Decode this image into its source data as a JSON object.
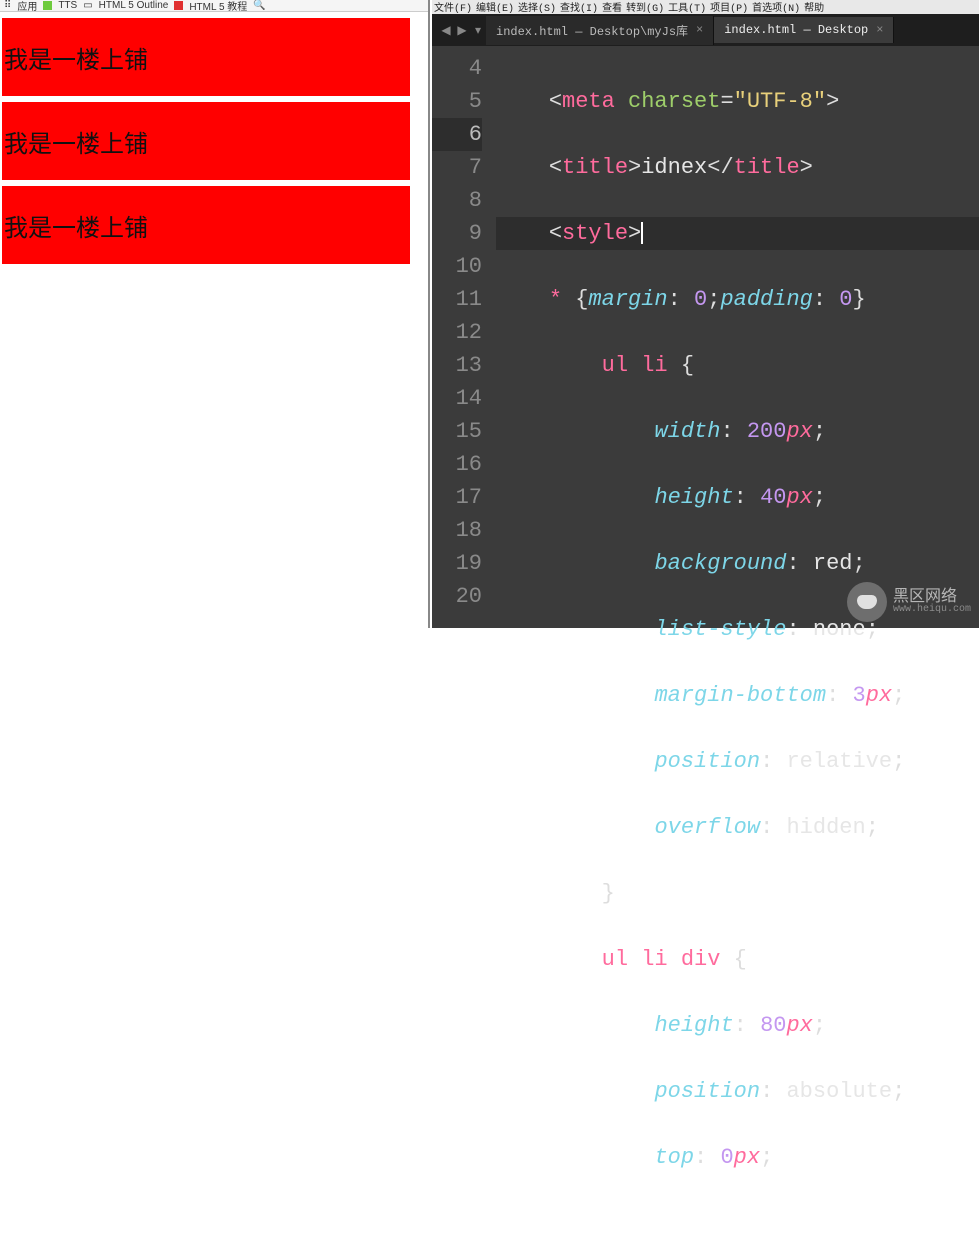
{
  "browser": {
    "bookmarks": {
      "apps": "应用",
      "tts": "TTS",
      "item1": "HTML 5 Outline",
      "item2": "HTML 5 教程"
    },
    "bars": {
      "b0": "我是一楼上铺",
      "b1": "我是一楼上铺",
      "b2": "我是一楼上铺"
    }
  },
  "editor": {
    "menus": {
      "m0": "文件(F)",
      "m1": "编辑(E)",
      "m2": "选择(S)",
      "m3": "查找(I)",
      "m4": "查看",
      "m5": "转到(G)",
      "m6": "工具(T)",
      "m7": "项目(P)",
      "m8": "首选项(N)",
      "m9": "帮助"
    },
    "tabs": {
      "t0": "index.html — Desktop\\myJs库",
      "t1": "index.html — Desktop",
      "close": "×"
    },
    "lines": {
      "l4": "4",
      "l5": "5",
      "l6": "6",
      "l7": "7",
      "l8": "8",
      "l9": "9",
      "l10": "10",
      "l11": "11",
      "l12": "12",
      "l13": "13",
      "l14": "14",
      "l15": "15",
      "l16": "16",
      "l17": "17",
      "l18": "18",
      "l19": "19",
      "l20": "20"
    },
    "code": {
      "meta_tag": "meta",
      "charset_attr": "charset",
      "charset_val": "\"UTF-8\"",
      "title_tag": "title",
      "title_text": "idnex",
      "style_tag": "style",
      "star": "*",
      "margin": "margin",
      "padding": "padding",
      "zero": "0",
      "sel_ulli": "ul li",
      "sel_ullidiv": "ul li div",
      "width": "width",
      "w_val": "200",
      "height": "height",
      "h_val": "40",
      "h2_val": "80",
      "px": "px",
      "background": "background",
      "red": "red",
      "liststyle": "list-style",
      "none": "none",
      "marginbottom": "margin-bottom",
      "mb_val": "3",
      "position": "position",
      "relative": "relative",
      "absolute": "absolute",
      "overflow": "overflow",
      "hidden": "hidden",
      "top": "top",
      "top_val": "0"
    },
    "watermark": {
      "line1": "黑区网络",
      "line2": "www.heiqu.com"
    }
  }
}
